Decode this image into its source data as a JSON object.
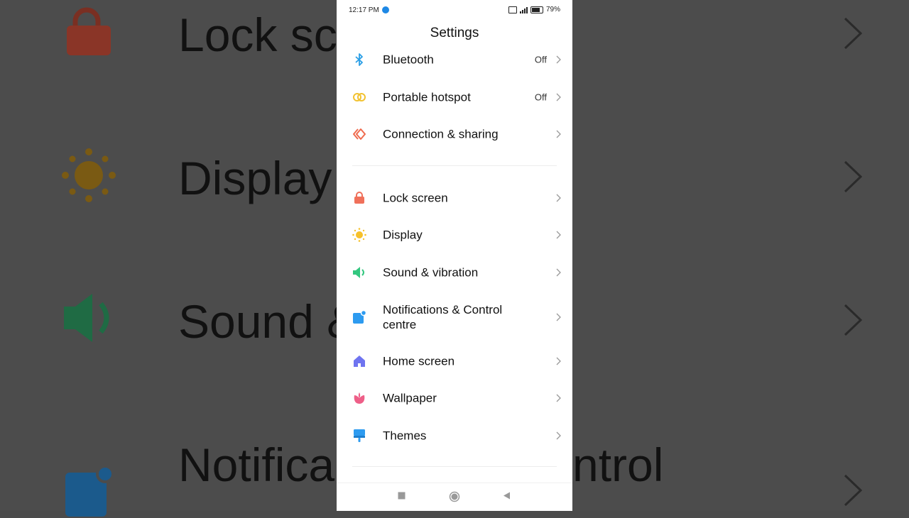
{
  "status_bar": {
    "time": "12:17 PM",
    "battery": "79%",
    "network": "4G"
  },
  "page": {
    "title": "Settings"
  },
  "groups": [
    {
      "items": [
        {
          "label": "Bluetooth",
          "value": "Off",
          "icon": "bluetooth-icon",
          "color": "#2b9fe6"
        },
        {
          "label": "Portable hotspot",
          "value": "Off",
          "icon": "hotspot-icon",
          "color": "#f2c230"
        },
        {
          "label": "Connection & sharing",
          "value": "",
          "icon": "connection-sharing-icon",
          "color": "#ef6b4e"
        }
      ]
    },
    {
      "items": [
        {
          "label": "Lock screen",
          "value": "",
          "icon": "lock-icon",
          "color": "#f0705a"
        },
        {
          "label": "Display",
          "value": "",
          "icon": "sun-icon",
          "color": "#f6c12b"
        },
        {
          "label": "Sound & vibration",
          "value": "",
          "icon": "speaker-icon",
          "color": "#33c77f"
        },
        {
          "label": "Notifications & Control centre",
          "value": "",
          "icon": "notifications-icon",
          "color": "#2d9bf0"
        },
        {
          "label": "Home screen",
          "value": "",
          "icon": "home-icon",
          "color": "#6f74f0"
        },
        {
          "label": "Wallpaper",
          "value": "",
          "icon": "wallpaper-flower-icon",
          "color": "#ee5f88"
        },
        {
          "label": "Themes",
          "value": "",
          "icon": "themes-brush-icon",
          "color": "#2d9bf0"
        }
      ]
    }
  ],
  "background": {
    "labels": [
      "Lock sc",
      "Display",
      "Sound &",
      "Notifica",
      "ntrol"
    ]
  },
  "navbar": {
    "icons": [
      "recents-square-icon",
      "home-circle-icon",
      "back-triangle-icon"
    ]
  }
}
